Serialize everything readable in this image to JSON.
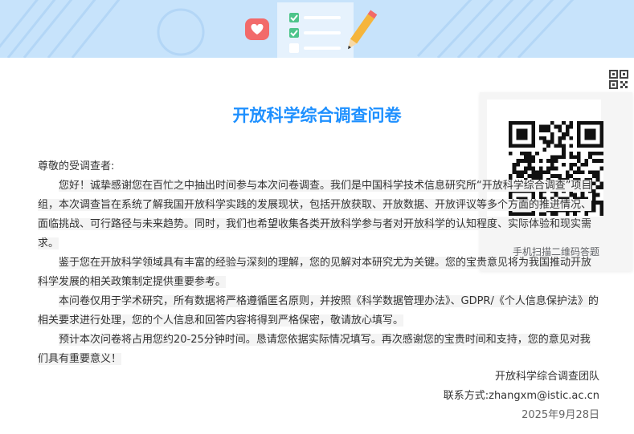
{
  "header": {
    "title": "开放科学综合调查问卷"
  },
  "qr": {
    "toggle_icon": "qrcode-icon",
    "caption": "手机扫描二维码答题"
  },
  "letter": {
    "greeting": "尊敬的受调查者:",
    "paragraphs": [
      "您好！诚挚感谢您在百忙之中抽出时间参与本次问卷调查。我们是中国科学技术信息研究所“开放科学综合调查”项目组，本次调查旨在系统了解我国开放科学实践的发展现状，包括开放获取、开放数据、开放评议等多个方面的推进情况、面临挑战、可行路径与未来趋势。同时，我们也希望收集各类开放科学参与者对开放科学的认知程度、实际体验和现实需求。",
      "鉴于您在开放科学领域具有丰富的经验与深刻的理解，您的见解对本研究尤为关键。您的宝贵意见将为我国推动开放科学发展的相关政策制定提供重要参考。",
      "本问卷仅用于学术研究，所有数据将严格遵循匿名原则，并按照《科学数据管理办法》、GDPR/《个人信息保护法》的相关要求进行处理，您的个人信息和回答内容将得到严格保密，敬请放心填写。",
      "预计本次问卷将占用您约20-25分钟时间。恳请您依据实际情况填写。再次感谢您的宝贵时间和支持，您的意见对我们具有重要意义！"
    ]
  },
  "signature": {
    "team": "开放科学综合调查团队",
    "contact": "联系方式:zhangxm@istic.ac.cn",
    "date": "2025年9月28日"
  },
  "colors": {
    "accent": "#1e90ff",
    "banner": "#c7e3fb",
    "check": "#4cc48a",
    "heart": "#f26a6a",
    "pencil": "#f5b53c"
  }
}
